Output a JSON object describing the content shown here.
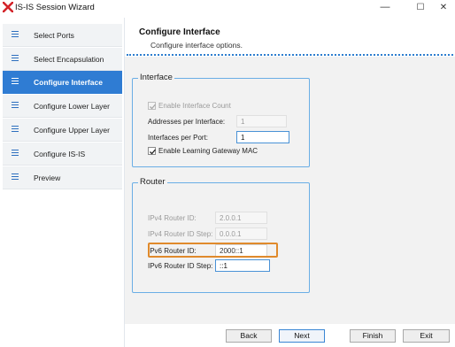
{
  "window": {
    "title": "IS-IS Session Wizard",
    "minimize_glyph": "—",
    "maximize_glyph": "☐",
    "close_glyph": "✕"
  },
  "sidebar": {
    "items": [
      {
        "label": "Select Ports",
        "icon": "list-icon"
      },
      {
        "label": "Select Encapsulation",
        "icon": "list-icon"
      },
      {
        "label": "Configure Interface",
        "icon": "list-icon",
        "active": true
      },
      {
        "label": "Configure Lower Layer",
        "icon": "list-icon"
      },
      {
        "label": "Configure Upper Layer",
        "icon": "list-icon"
      },
      {
        "label": "Configure IS-IS",
        "icon": "list-icon"
      },
      {
        "label": "Preview",
        "icon": "list-icon"
      }
    ]
  },
  "header": {
    "title": "Configure Interface",
    "subtitle": "Configure interface options."
  },
  "interface": {
    "legend": "Interface",
    "enable_interface_count_label": "Enable Interface Count",
    "enable_interface_count_checked": true,
    "addresses_per_interface_label": "Addresses per Interface:",
    "addresses_per_interface_value": "1",
    "interfaces_per_port_label": "Interfaces per Port:",
    "interfaces_per_port_value": "1",
    "enable_learning_gateway_mac_label": "Enable Learning Gateway MAC",
    "enable_learning_gateway_mac_checked": true
  },
  "router": {
    "legend": "Router",
    "ipv4_router_id_label": "IPv4 Router ID:",
    "ipv4_router_id_value": "2.0.0.1",
    "ipv4_router_id_step_label": "IPv4 Router ID Step:",
    "ipv4_router_id_step_value": "0.0.0.1",
    "ipv6_router_id_label": "IPv6 Router ID:",
    "ipv6_router_id_value": "2000::1",
    "ipv6_router_id_step_label": "IPv6 Router ID Step:",
    "ipv6_router_id_step_value": "::1"
  },
  "footer": {
    "back_label": "Back",
    "next_label": "Next",
    "finish_label": "Finish",
    "exit_label": "Exit"
  },
  "colors": {
    "accent": "#2f7cd3",
    "highlight": "#e08a2c",
    "group_border": "#6aaee5"
  }
}
